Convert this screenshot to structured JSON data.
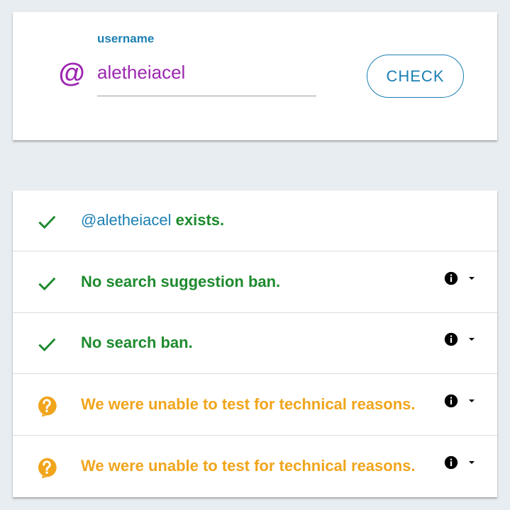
{
  "search": {
    "at_symbol": "@",
    "label": "username",
    "value": "aletheiacel",
    "button_label": "CHECK"
  },
  "results": [
    {
      "status": "ok",
      "user_prefix": "@aletheiacel",
      "text": " exists.",
      "has_details": false
    },
    {
      "status": "ok",
      "text": "No search suggestion ban.",
      "has_details": true
    },
    {
      "status": "ok",
      "text": "No search ban.",
      "has_details": true
    },
    {
      "status": "unknown",
      "text": "We were unable to test for technical reasons.",
      "has_details": true
    },
    {
      "status": "unknown",
      "text": "We were unable to test for technical reasons.",
      "has_details": true
    }
  ],
  "colors": {
    "ok": "#1e8a2e",
    "warn": "#f0a51c",
    "accent": "#1b7fb3",
    "purple": "#9c27b0"
  },
  "icons": {
    "ok": "checkmark-icon",
    "unknown": "question-bubble-icon",
    "info": "info-icon",
    "expand": "caret-down-icon"
  }
}
